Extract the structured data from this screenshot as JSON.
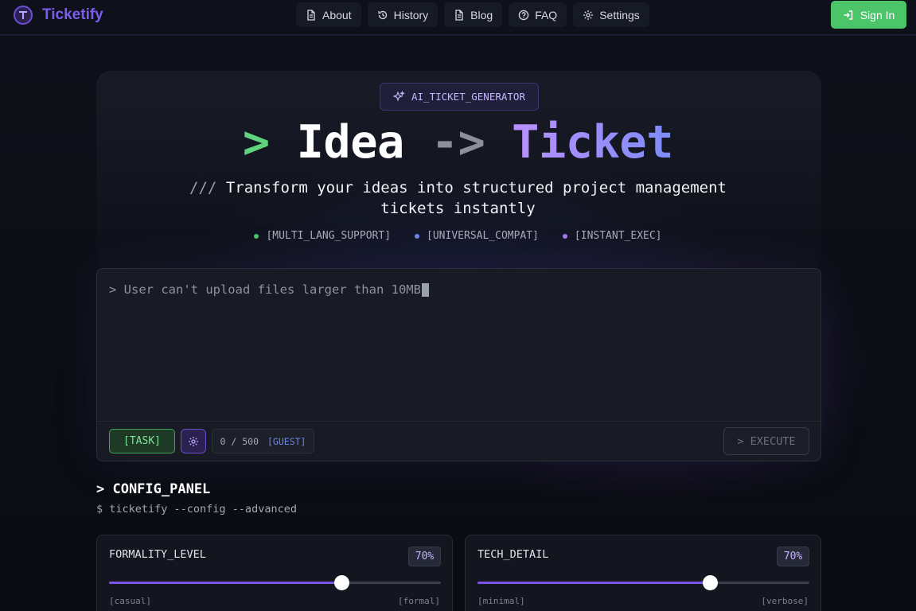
{
  "app": {
    "name": "Ticketify"
  },
  "nav": [
    {
      "label": "About",
      "icon": "document-icon"
    },
    {
      "label": "History",
      "icon": "history-icon"
    },
    {
      "label": "Blog",
      "icon": "document-icon"
    },
    {
      "label": "FAQ",
      "icon": "help-circle-icon"
    },
    {
      "label": "Settings",
      "icon": "gear-icon"
    }
  ],
  "signin": {
    "label": "Sign In"
  },
  "hero": {
    "badge": "AI_TICKET_GENERATOR",
    "title_prompt": ">",
    "title_idea": "Idea",
    "title_arrow": "->",
    "title_ticket": "Ticket",
    "subtitle_prefix": "///",
    "subtitle": "Transform your ideas into structured project management tickets instantly",
    "features": [
      {
        "label": "[MULTI_LANG_SUPPORT]",
        "color": "#4cc46a"
      },
      {
        "label": "[UNIVERSAL_COMPAT]",
        "color": "#6f86ec"
      },
      {
        "label": "[INSTANT_EXEC]",
        "color": "#a978ee"
      }
    ]
  },
  "input": {
    "text": "> User can't upload files larger than 10MB",
    "task_label": "[TASK]",
    "counter": "0 / 500",
    "counter_badge": "[GUEST]",
    "execute_label": "> EXECUTE"
  },
  "config": {
    "title": "> CONFIG_PANEL",
    "command": "$ ticketify --config --advanced",
    "sliders": [
      {
        "label": "FORMALITY_LEVEL",
        "value": 70,
        "display": "70%",
        "min_label": "[casual]",
        "max_label": "[formal]"
      },
      {
        "label": "TECH_DETAIL",
        "value": 70,
        "display": "70%",
        "min_label": "[minimal]",
        "max_label": "[verbose]"
      }
    ]
  },
  "colors": {
    "accent": "#7b55e8",
    "brand": "#7c5cf0",
    "success": "#4bc46a"
  }
}
